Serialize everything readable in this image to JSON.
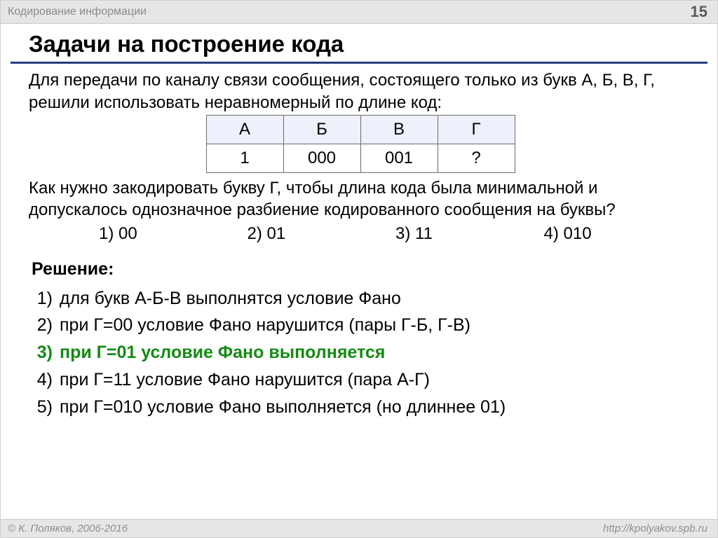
{
  "header": {
    "breadcrumb": "Кодирование информации",
    "page_number": "15"
  },
  "title": "Задачи на построение кода",
  "problem": {
    "intro": "Для передачи по каналу связи сообщения, состоящего только из букв А, Б, В, Г, решили использовать неравномерный по длине код:",
    "table": {
      "letters": [
        "А",
        "Б",
        "В",
        "Г"
      ],
      "codes": [
        "1",
        "000",
        "001",
        "?"
      ]
    },
    "question": "Как нужно закодировать букву Г, чтобы длина кода была минимальной и допускалось однозначное разбиение кодированного сообщения на буквы?",
    "options": [
      "1) 00",
      "2) 01",
      "3) 11",
      "4) 010"
    ]
  },
  "solution": {
    "heading": "Решение",
    "steps": [
      {
        "n": "1)",
        "text": "для букв А-Б-В выполнятся условие Фано",
        "correct": false
      },
      {
        "n": "2)",
        "text": "при Г=00 условие Фано нарушится (пары Г-Б,  Г-В)",
        "correct": false
      },
      {
        "n": "3)",
        "text": "при Г=01 условие Фано выполняется",
        "correct": true
      },
      {
        "n": "4)",
        "text": "при Г=11 условие Фано нарушится (пара А-Г)",
        "correct": false
      },
      {
        "n": "5)",
        "text": "при Г=010 условие Фано выполняется (но длиннее 01)",
        "correct": false
      }
    ]
  },
  "footer": {
    "copyright": "© К. Поляков, 2006-2016",
    "url": "http://kpolyakov.spb.ru"
  }
}
